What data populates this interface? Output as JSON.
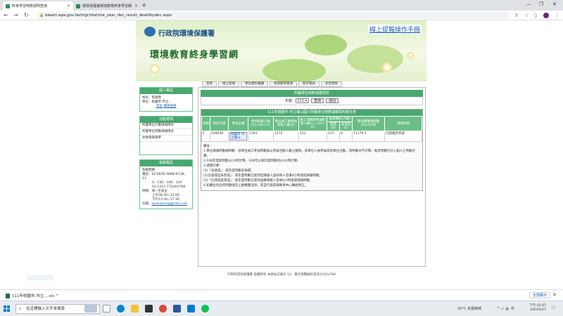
{
  "browser": {
    "tabs": [
      {
        "title": "終身學習時數證明查詢",
        "active": true
      },
      {
        "title": "環境保護署環境教育終身學習網",
        "active": false
      }
    ],
    "url": "elearn.epa.gov.tw/mgr/stat/sta_year_dec_result_deatilbydec.aspx"
  },
  "header": {
    "agency": "行政院環境保護署",
    "site_title": "環境教育終身學習網",
    "manual_link": "線上提報操作手冊"
  },
  "menu": [
    "首頁",
    "線上提報",
    "單位資料維護",
    "環境教育資源",
    "統計報表",
    "訊息發佈"
  ],
  "sidebar": {
    "personal": {
      "title": "個人專區",
      "name_label": "姓名：",
      "name": "張遼霖",
      "unit_label": "單位：",
      "unit": "桃園市-市立...",
      "logout": "登出",
      "change_password": "變更密碼"
    },
    "functions": {
      "title": "功能選項",
      "items": [
        "所屬單位計畫填報情形",
        "所屬單位時數填報情形",
        "合併填報清單"
      ]
    },
    "contact": {
      "title": "客服專區",
      "lines": [
        "系統問題",
        "電話：02-6630-3688(#138、13",
        "0、136、109、129",
        "02-2311-7722#2768",
        "時間：週一至週五",
        "上午08:30~12:00",
        "下午13:30~17:30"
      ],
      "email_label": "信箱：",
      "email": "epaelearn@gmail.com"
    }
  },
  "content": {
    "header": "所屬單位時數填報情形",
    "year_label": "年度:",
    "year_value": "111",
    "query_button": "查詢",
    "back_button": "返回",
    "report_title": "111年桃園市-市立龜山國小所屬單位時數填報情形統計表",
    "columns": [
      "序號",
      "單位代碼",
      "單位名稱",
      "參加對象人數(A)=(B)+(C)",
      "單位員工應參加對象人數(B)",
      "員工或教師參加對象人數(C)=(D)+(E)",
      "達成(D)",
      "未達成(E)",
      "單位總填報時數(A)x4小時",
      "填報狀態"
    ],
    "group_header": "達成情形(人數)",
    "rows": [
      {
        "no": "1",
        "code": "034636",
        "name_button": "桃園市-市立龜山...",
        "a": "1393",
        "b": "1272",
        "c": "121",
        "d": "121",
        "e": "0",
        "hours": "11179.5",
        "status": "已提報且完成"
      }
    ],
    "notes": [
      "備註：",
      "1.單位填報時數總時數：該單位員工參加時數與以參與活動人數之總和，該單位人員參與其他單位活動，其時數亦不計算；惟其時數仍計入個人之時數計算。",
      "2.108年度起時數以(3)時計算，108年以後年度時數則以(4)時計算。",
      "3.達標計算：",
      "(1)「未達成」：該年度時數未達標。",
      "(2)已達成但未完成」：該年度時數已達到但填報人並非每人皆填4小時達成填報時數。",
      "(3)「已達成且完成」：該年度時數已達到並應填報人皆填4小時達成填報時數。",
      "4.如欄位有任何問題請向上級機關洽詢，或自行與環境教育中心聯絡更正。"
    ]
  },
  "footer": "行政院環境保護署 版權所有 本網站支援IE 10、最佳瀏覽解析度為1024x768",
  "download": {
    "file": "111年桃園市-市立....xls",
    "show_all": "全部顯示"
  },
  "taskbar": {
    "search_placeholder": "在這裡輸入文字來搜尋",
    "weather": "25°C 多雲時晴",
    "time": "下午 05:07",
    "date": "2023/4/27"
  }
}
